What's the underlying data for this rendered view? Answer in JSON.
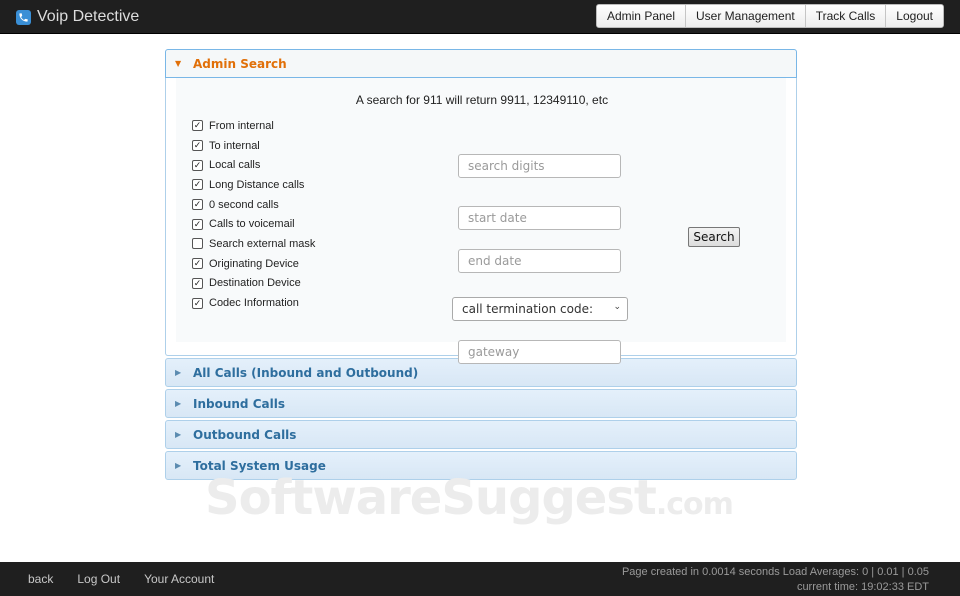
{
  "app": {
    "title": "Voip Detective",
    "logo_icon": "phone-icon",
    "accent": "#3a8fd6"
  },
  "nav": {
    "items": [
      "Admin Panel",
      "User Management",
      "Track Calls",
      "Logout"
    ]
  },
  "admin_search": {
    "header": "Admin Search",
    "hint": "A search for 911 will return 9911, 12349110, etc",
    "checkboxes": [
      {
        "label": "From internal",
        "checked": true
      },
      {
        "label": "To internal",
        "checked": true
      },
      {
        "label": "Local calls",
        "checked": true
      },
      {
        "label": "Long Distance calls",
        "checked": true
      },
      {
        "label": "0 second calls",
        "checked": true
      },
      {
        "label": "Calls to voicemail",
        "checked": true
      },
      {
        "label": "Search external mask",
        "checked": false
      },
      {
        "label": "Originating Device",
        "checked": true
      },
      {
        "label": "Destination Device",
        "checked": true
      },
      {
        "label": "Codec Information",
        "checked": true
      }
    ],
    "inputs": {
      "digits_placeholder": "search digits",
      "start_placeholder": "start date",
      "end_placeholder": "end date",
      "gateway_placeholder": "gateway"
    },
    "select_value": "call termination code:",
    "search_button": "Search"
  },
  "sections": [
    "All Calls (Inbound and Outbound)",
    "Inbound Calls",
    "Outbound Calls",
    "Total System Usage"
  ],
  "watermark": {
    "main": "SoftwareSuggest",
    "suffix": ".com"
  },
  "footer": {
    "links": [
      "back",
      "Log Out",
      "Your Account"
    ],
    "page_created": "Page created in 0.0014 seconds Load Averages: 0 | 0.01 | 0.05",
    "current_time": "current time: 19:02:33 EDT"
  }
}
